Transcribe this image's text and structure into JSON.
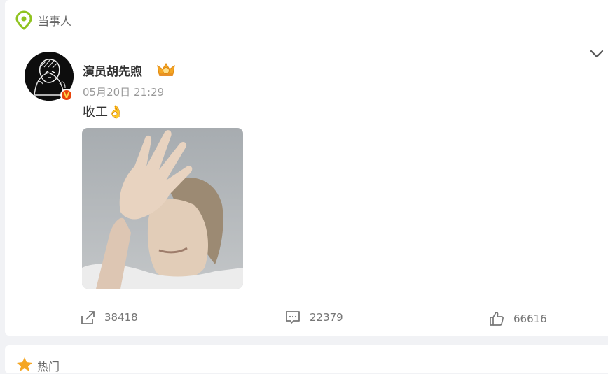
{
  "header": {
    "title": "当事人",
    "icon": "location-pin-icon",
    "icon_color": "#8fc31f"
  },
  "post": {
    "username": "演员胡先煦",
    "verified_badge": "V",
    "timestamp": "05月20日 21:29",
    "text": "收工👌",
    "image_alt": "post-photo",
    "menu_icon": "chevron-down-icon"
  },
  "actions": {
    "repost_count": "38418",
    "comment_count": "22379",
    "like_count": "66616"
  },
  "next_section": {
    "title": "热门"
  },
  "colors": {
    "background": "#f1f2f5",
    "card": "#ffffff",
    "accent_green": "#8fc31f",
    "verified_orange": "#e8450c",
    "hot_orange": "#f5a623"
  }
}
